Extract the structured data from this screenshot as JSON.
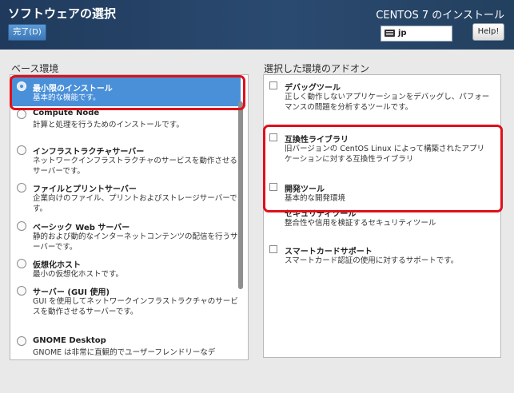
{
  "header": {
    "spoke_title": "ソフトウェアの選択",
    "done_label": "完了(D)",
    "product_title": "CENTOS 7 のインストール",
    "keyboard_layout": "jp",
    "help_label": "Help!"
  },
  "base_environment": {
    "label": "ベース環境",
    "items": [
      {
        "title": "最小限のインストール",
        "desc": "基本的な機能です。",
        "selected": true
      },
      {
        "title": "Compute Node",
        "desc": "計算と処理を行うためのインストールです。"
      },
      {
        "title": "インフラストラクチャサーバー",
        "desc": "ネットワークインフラストラクチャのサービスを動作させるサーバーです。"
      },
      {
        "title": "ファイルとプリントサーバー",
        "desc": "企業向けのファイル、プリントおよびストレージサーバーです。"
      },
      {
        "title": "ベーシック Web サーバー",
        "desc": "静的および動的なインターネットコンテンツの配信を行うサーバーです。"
      },
      {
        "title": "仮想化ホスト",
        "desc": "最小の仮想化ホストです。"
      },
      {
        "title": "サーバー (GUI 使用)",
        "desc": "GUI を使用してネットワークインフラストラクチャのサービスを動作させるサーバーです。"
      },
      {
        "title": "GNOME Desktop",
        "desc": "GNOME は非常に直観的でユーザーフレンドリーなデ"
      }
    ]
  },
  "addons": {
    "label": "選択した環境のアドオン",
    "items": [
      {
        "title": "デバッグツール",
        "desc": "正しく動作しないアプリケーションをデバッグし、パフォーマンスの問題を分析するツールです。"
      },
      {
        "title": "互換性ライブラリ",
        "desc": "旧バージョンの CentOS Linux によって構築されたアプリケーションに対する互換性ライブラリ"
      },
      {
        "title": "開発ツール",
        "desc": "基本的な開発環境"
      },
      {
        "title": "セキュリティツール",
        "desc": "整合性や信用を検証するセキュリティツール"
      },
      {
        "title": "スマートカードサポート",
        "desc": "スマートカード認証の使用に対するサポートです。"
      }
    ]
  },
  "annotation_color": "#e0101a",
  "accent_color": "#4a90d9"
}
